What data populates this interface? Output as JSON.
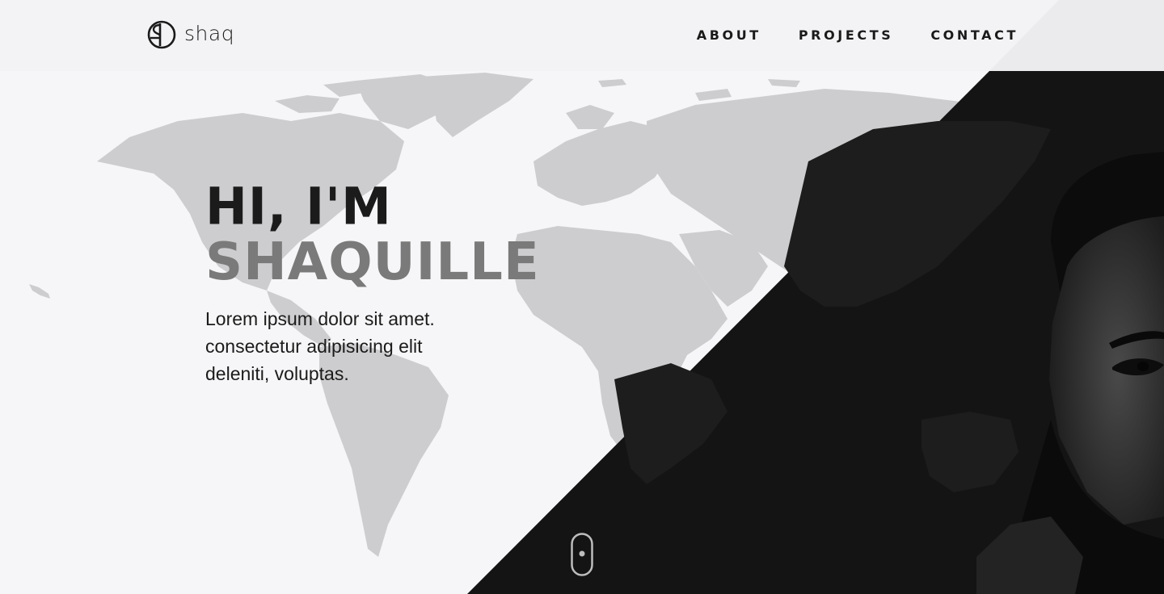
{
  "header": {
    "logo_text": "shaq",
    "logo_icon": "sd-monogram-icon",
    "nav": [
      {
        "label": "ABOUT"
      },
      {
        "label": "PROJECTS"
      },
      {
        "label": "CONTACT"
      }
    ]
  },
  "hero": {
    "greeting": "HI, I'M",
    "name": "SHAQUILLE",
    "description_lines": [
      "Lorem ipsum dolor sit amet.",
      "consectetur adipisicing elit",
      "deleniti, voluptas."
    ]
  },
  "icons": {
    "scroll": "mouse-scroll-icon",
    "background": "world-map-graphic",
    "portrait": "portrait-photo"
  },
  "colors": {
    "background": "#f6f6f8",
    "dark_panel": "#141414",
    "heading_dark": "#1b1b1b",
    "heading_gray": "#7a7a7a",
    "map_gray": "#c8c8ca"
  }
}
